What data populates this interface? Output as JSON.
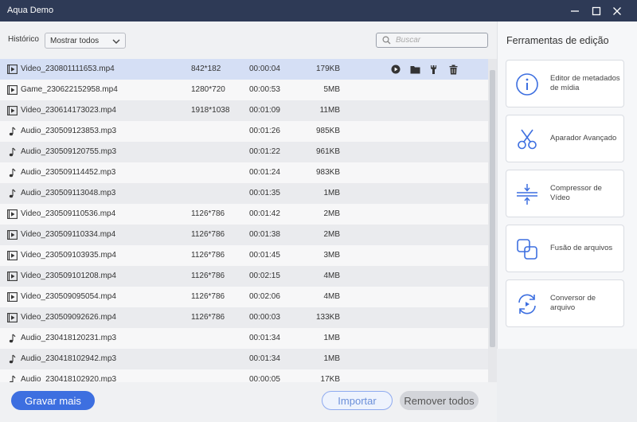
{
  "window": {
    "title": "Aqua Demo"
  },
  "filter": {
    "history_label": "Histórico",
    "select_value": "Mostrar todos",
    "search_placeholder": "Buscar"
  },
  "files": [
    {
      "type": "video",
      "name": "Video_230801111653.mp4",
      "resolution": "842*182",
      "duration": "00:00:04",
      "size": "179KB",
      "selected": true
    },
    {
      "type": "video",
      "name": "Game_230622152958.mp4",
      "resolution": "1280*720",
      "duration": "00:00:53",
      "size": "5MB"
    },
    {
      "type": "video",
      "name": "Video_230614173023.mp4",
      "resolution": "1918*1038",
      "duration": "00:01:09",
      "size": "11MB"
    },
    {
      "type": "audio",
      "name": "Audio_230509123853.mp3",
      "resolution": "",
      "duration": "00:01:26",
      "size": "985KB"
    },
    {
      "type": "audio",
      "name": "Audio_230509120755.mp3",
      "resolution": "",
      "duration": "00:01:22",
      "size": "961KB"
    },
    {
      "type": "audio",
      "name": "Audio_230509114452.mp3",
      "resolution": "",
      "duration": "00:01:24",
      "size": "983KB"
    },
    {
      "type": "audio",
      "name": "Audio_230509113048.mp3",
      "resolution": "",
      "duration": "00:01:35",
      "size": "1MB"
    },
    {
      "type": "video",
      "name": "Video_230509110536.mp4",
      "resolution": "1126*786",
      "duration": "00:01:42",
      "size": "2MB"
    },
    {
      "type": "video",
      "name": "Video_230509110334.mp4",
      "resolution": "1126*786",
      "duration": "00:01:38",
      "size": "2MB"
    },
    {
      "type": "video",
      "name": "Video_230509103935.mp4",
      "resolution": "1126*786",
      "duration": "00:01:45",
      "size": "3MB"
    },
    {
      "type": "video",
      "name": "Video_230509101208.mp4",
      "resolution": "1126*786",
      "duration": "00:02:15",
      "size": "4MB"
    },
    {
      "type": "video",
      "name": "Video_230509095054.mp4",
      "resolution": "1126*786",
      "duration": "00:02:06",
      "size": "4MB"
    },
    {
      "type": "video",
      "name": "Video_230509092626.mp4",
      "resolution": "1126*786",
      "duration": "00:00:03",
      "size": "133KB"
    },
    {
      "type": "audio",
      "name": "Audio_230418120231.mp3",
      "resolution": "",
      "duration": "00:01:34",
      "size": "1MB"
    },
    {
      "type": "audio",
      "name": "Audio_230418102942.mp3",
      "resolution": "",
      "duration": "00:01:34",
      "size": "1MB"
    },
    {
      "type": "audio",
      "name": "Audio_230418102920.mp3",
      "resolution": "",
      "duration": "00:00:05",
      "size": "17KB"
    }
  ],
  "row_actions": [
    "play-icon",
    "folder-icon",
    "wrench-icon",
    "trash-icon"
  ],
  "bottom": {
    "record_more": "Gravar mais",
    "import": "Importar",
    "remove_all": "Remover todos"
  },
  "tools": {
    "title": "Ferramentas de edição",
    "items": [
      {
        "label": "Editor de metadados de mídia",
        "icon": "info-icon"
      },
      {
        "label": "Aparador Avançado",
        "icon": "scissors-icon"
      },
      {
        "label": "Compressor de Vídeo",
        "icon": "compress-icon"
      },
      {
        "label": "Fusão de arquivos",
        "icon": "merge-icon"
      },
      {
        "label": "Conversor de arquivo",
        "icon": "convert-icon"
      }
    ]
  },
  "colors": {
    "titlebar": "#2e3a56",
    "accent": "#3d6fe0",
    "selected_row": "#d5dff5",
    "tool_icon": "#3d6fe0"
  }
}
